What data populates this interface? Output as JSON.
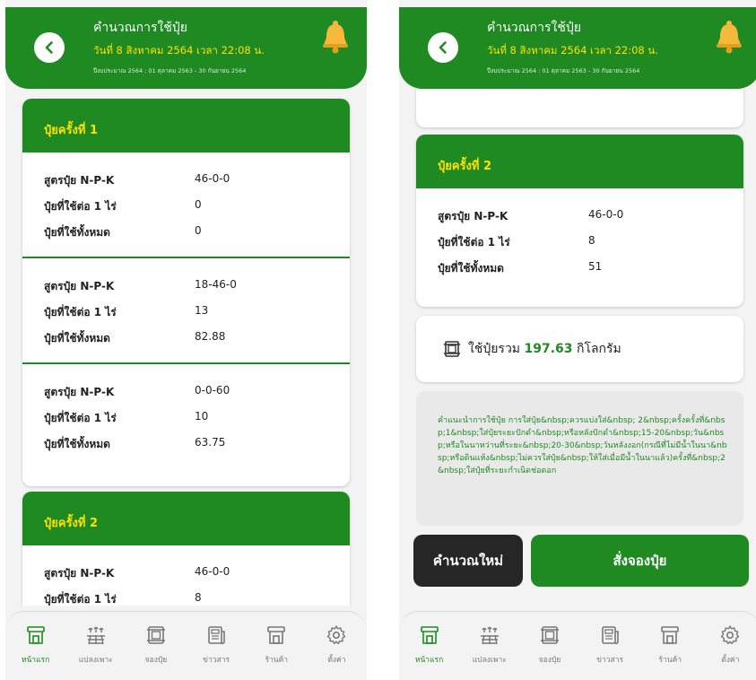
{
  "colors": {
    "primary": "#1e8a21",
    "accent": "#ffe100",
    "dark_button": "#262626"
  },
  "header": {
    "title": "คำนวณการใช้ปุ๋ย",
    "date": "วันที่ 8 สิงหาคม 2564 เวลา 22:08 น.",
    "season": "ปีงบประมาณ 2564 : 01 ตุลาคม 2563 - 30 กันยายน 2564",
    "back_icon": "chevron-left-icon",
    "bell_icon": "bell-icon"
  },
  "left": {
    "card1": {
      "title": "ปุ๋ยครั้งที่ 1",
      "groups": [
        {
          "formula_label": "สูตรปุ๋ย N-P-K",
          "formula": "46-0-0",
          "per_rai_label": "ปุ๋ยที่ใช้ต่อ 1 ไร่",
          "per_rai": "0",
          "total_label": "ปุ๋ยที่ใช้ทั้งหมด",
          "total": "0"
        },
        {
          "formula_label": "สูตรปุ๋ย N-P-K",
          "formula": "18-46-0",
          "per_rai_label": "ปุ๋ยที่ใช้ต่อ 1 ไร่",
          "per_rai": "13",
          "total_label": "ปุ๋ยที่ใช้ทั้งหมด",
          "total": "82.88"
        },
        {
          "formula_label": "สูตรปุ๋ย N-P-K",
          "formula": "0-0-60",
          "per_rai_label": "ปุ๋ยที่ใช้ต่อ 1 ไร่",
          "per_rai": "10",
          "total_label": "ปุ๋ยที่ใช้ทั้งหมด",
          "total": "63.75"
        }
      ]
    },
    "card2": {
      "title": "ปุ๋ยครั้งที่ 2",
      "groups": [
        {
          "formula_label": "สูตรปุ๋ย N-P-K",
          "formula": "46-0-0",
          "per_rai_label": "ปุ๋ยที่ใช้ต่อ 1 ไร่",
          "per_rai": "8"
        }
      ]
    }
  },
  "right": {
    "card2": {
      "title": "ปุ๋ยครั้งที่ 2",
      "groups": [
        {
          "formula_label": "สูตรปุ๋ย N-P-K",
          "formula": "46-0-0",
          "per_rai_label": "ปุ๋ยที่ใช้ต่อ 1 ไร่",
          "per_rai": "8",
          "total_label": "ปุ๋ยที่ใช้ทั้งหมด",
          "total": "51"
        }
      ]
    },
    "total": {
      "prefix": "ใช้ปุ๋ยรวม",
      "amount": "197.63",
      "unit": "กิโลกรัม",
      "icon": "sack-icon"
    },
    "advice": "คำแนะนำการใช้ปุ๋ย การใส่ปุ๋ย&nbsp;ควรแบ่งใส่&nbsp; 2&nbsp;ครั้งครั้งที่&nbsp;1&nbsp;ใส่ปุ๋ยระยะปักดำ&nbsp;หรือหลังปักดำ&nbsp;15-20&nbsp;วัน&nbsp;หรือในนาหว่านที่ระยะ&nbsp;20-30&nbsp;วันหลังงอก(กรณีที่ไม่มีน้ำในนา&nbsp;หรือดินแห้ง&nbsp;ไม่ควรใส่ปุ๋ย&nbsp;ให้ใส่เมื่อมีน้ำในนาแล้ว)ครั้งที่&nbsp;2&nbsp;ใส่ปุ๋ยที่ระยะกำเนิดช่อดอก",
    "buttons": {
      "recalculate": "คำนวณใหม่",
      "order": "สั่งจองปุ๋ย"
    }
  },
  "nav": [
    {
      "label": "หน้าแรก",
      "icon": "store-icon",
      "active": true
    },
    {
      "label": "แปลงเพาะ",
      "icon": "plant-plot-icon",
      "active": false
    },
    {
      "label": "จองปุ๋ย",
      "icon": "fertilizer-sack-icon",
      "active": false
    },
    {
      "label": "ข่าวสาร",
      "icon": "news-icon",
      "active": false
    },
    {
      "label": "ร้านค้า",
      "icon": "shop-icon",
      "active": false
    },
    {
      "label": "ตั้งค่า",
      "icon": "gear-icon",
      "active": false
    }
  ]
}
